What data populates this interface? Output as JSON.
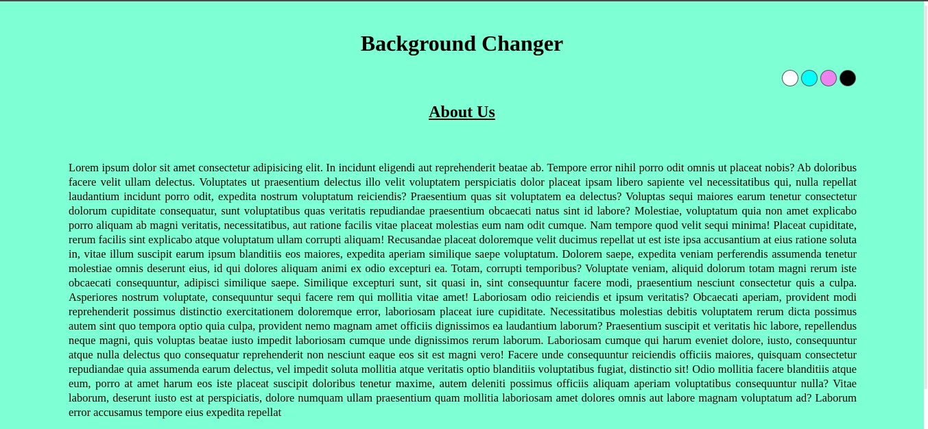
{
  "header": {
    "title": "Background Changer"
  },
  "swatches": [
    {
      "name": "white",
      "color": "#ffffff"
    },
    {
      "name": "cyan",
      "color": "#00ffff"
    },
    {
      "name": "violet",
      "color": "#ee82ee"
    },
    {
      "name": "black",
      "color": "#000000"
    }
  ],
  "colors": {
    "page_background": "#7fffd4"
  },
  "section": {
    "heading": "About Us",
    "paragraph": "Lorem ipsum dolor sit amet consectetur adipisicing elit. In incidunt eligendi aut reprehenderit beatae ab. Tempore error nihil porro odit omnis ut placeat nobis? Ab doloribus facere velit ullam delectus. Voluptates ut praesentium delectus illo velit voluptatem perspiciatis dolor placeat ipsam libero sapiente vel necessitatibus qui, nulla repellat laudantium incidunt porro odit, expedita nostrum voluptatum reiciendis? Praesentium quas sit voluptatem ea delectus? Voluptas sequi maiores earum tenetur consectetur dolorum cupiditate consequatur, sunt voluptatibus quas veritatis repudiandae praesentium obcaecati natus sint id labore? Molestiae, voluptatum quia non amet explicabo porro aliquam ab magni veritatis, necessitatibus, aut ratione facilis vitae placeat molestias eum nam odit cumque. Nam tempore quod velit sequi minima! Placeat cupiditate, rerum facilis sint explicabo atque voluptatum ullam corrupti aliquam! Recusandae placeat doloremque velit ducimus repellat ut est iste ipsa accusantium at eius ratione soluta in, vitae illum suscipit earum ipsum blanditiis eos maiores, expedita aperiam similique saepe voluptatum. Dolorem saepe, expedita veniam perferendis assumenda tenetur molestiae omnis deserunt eius, id qui dolores aliquam animi ex odio excepturi ea. Totam, corrupti temporibus? Voluptate veniam, aliquid dolorum totam magni rerum iste obcaecati consequuntur, adipisci similique saepe. Similique excepturi sunt, sit quasi in, sint consequuntur facere modi, praesentium nesciunt consectetur quis a culpa. Asperiores nostrum voluptate, consequuntur sequi facere rem qui mollitia vitae amet! Laboriosam odio reiciendis et ipsum veritatis? Obcaecati aperiam, provident modi reprehenderit possimus distinctio exercitationem doloremque error, laboriosam placeat iure cupiditate. Necessitatibus molestias debitis voluptatem rerum dicta possimus autem sint quo tempora optio quia culpa, provident nemo magnam amet officiis dignissimos ea laudantium laborum? Praesentium suscipit et veritatis hic labore, repellendus neque magni, quis voluptas beatae iusto impedit laboriosam cumque unde dignissimos rerum laborum. Laboriosam cumque qui harum eveniet dolore, iusto, consequuntur atque nulla delectus quo consequatur reprehenderit non nesciunt eaque eos sit est magni vero! Facere unde consequuntur reiciendis officiis maiores, quisquam consectetur repudiandae quia assumenda earum delectus, vel impedit soluta mollitia atque veritatis optio blanditiis voluptatibus fugiat, distinctio sit! Odio mollitia facere blanditiis atque eum, porro at amet harum eos iste placeat suscipit doloribus tenetur maxime, autem deleniti possimus officiis aliquam aperiam voluptatibus consequuntur nulla? Vitae laborum, deserunt iusto est at perspiciatis, dolore numquam ullam praesentium quam mollitia laboriosam amet dolores omnis aut labore magnam voluptatum ad? Laborum error accusamus tempore eius expedita repellat"
  }
}
